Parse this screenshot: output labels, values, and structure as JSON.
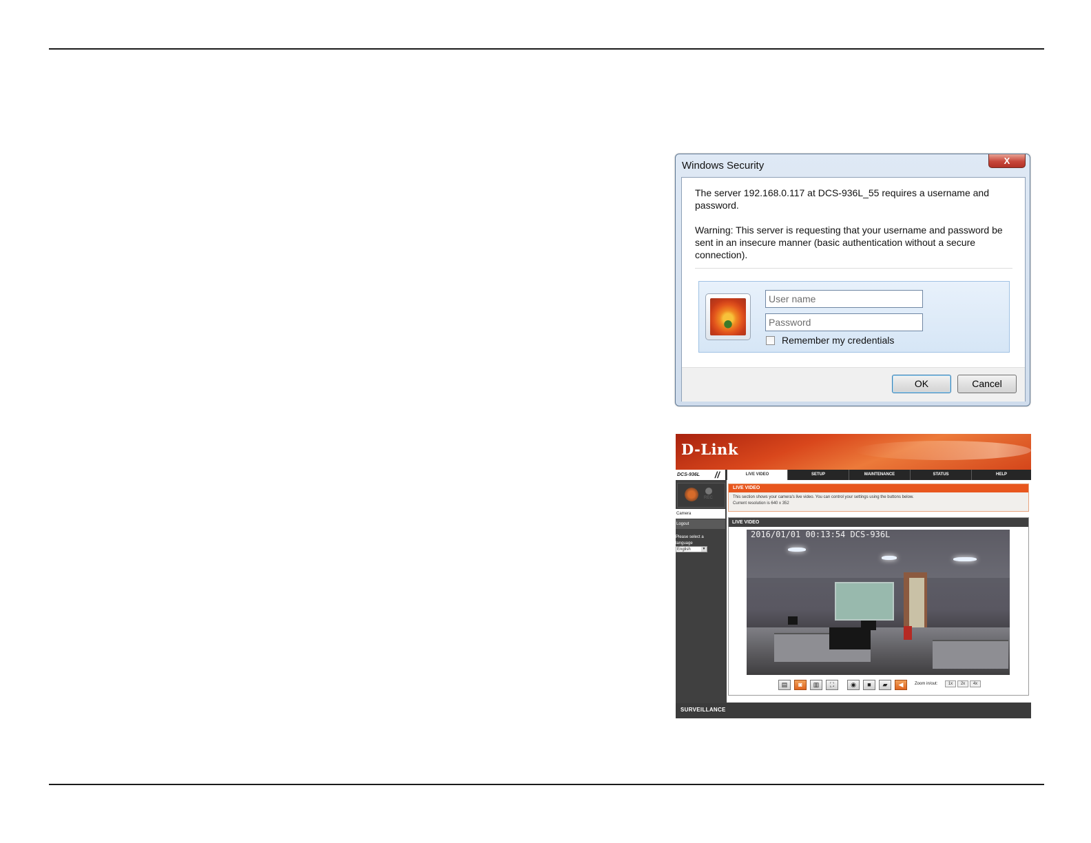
{
  "dialog": {
    "title": "Windows Security",
    "close_glyph": "X",
    "message_1": "The server 192.168.0.117 at DCS-936L_55 requires a username and password.",
    "message_2": "Warning: This server is requesting that your username and password be sent in an insecure manner (basic authentication without a secure connection).",
    "username_placeholder": "User name",
    "password_placeholder": "Password",
    "remember_label": "Remember my credentials",
    "remember_checked": false,
    "ok_label": "OK",
    "cancel_label": "Cancel"
  },
  "camera_ui": {
    "brand": "D-Link",
    "model": "DCS-936L",
    "model_slash": "//",
    "tabs": [
      {
        "label": "LIVE VIDEO",
        "active": true
      },
      {
        "label": "SETUP",
        "active": false
      },
      {
        "label": "MAINTENANCE",
        "active": false
      },
      {
        "label": "STATUS",
        "active": false
      },
      {
        "label": "HELP",
        "active": false
      }
    ],
    "sidebar": {
      "rec_label": "REC",
      "camera_link": "Camera",
      "logout_link": "Logout",
      "language_prompt": "Please select a language",
      "language_value": "English"
    },
    "banner": {
      "title": "LIVE VIDEO",
      "description_1": "This section shows your camera's live video. You can control your settings using the buttons below.",
      "description_2": "Current resolution is 640 x 352"
    },
    "section_title": "LIVE VIDEO",
    "video_timestamp": "2016/01/01 00:13:54 DCS-936L",
    "zoom_label": "Zoom in/out:",
    "zoom_buttons": [
      "1x",
      "2x",
      "4x"
    ],
    "footer_text": "SURVEILLANCE",
    "accent_color": "#e8561d"
  }
}
